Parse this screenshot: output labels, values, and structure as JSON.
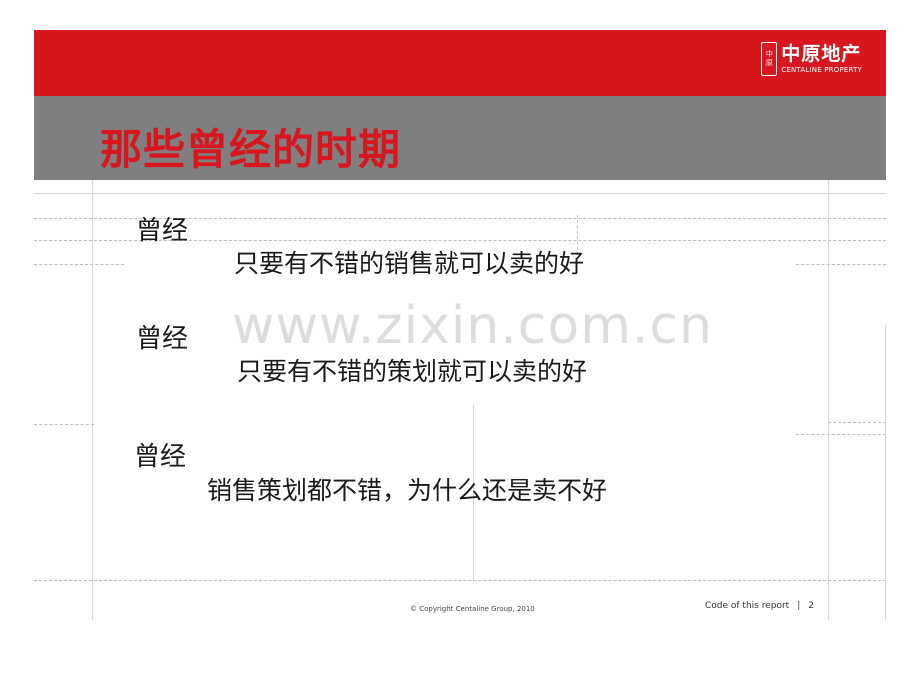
{
  "logo": {
    "seal_top": "中",
    "seal_bottom": "原",
    "name_cn": "中原地产",
    "name_en": "CENTALINE PROPERTY"
  },
  "title": "那些曾经的时期",
  "items": [
    {
      "label": "曾经",
      "text": "只要有不错的销售就可以卖的好"
    },
    {
      "label": "曾经",
      "text": "只要有不错的策划就可以卖的好"
    },
    {
      "label": "曾经",
      "text": "销售策划都不错，为什么还是卖不好"
    }
  ],
  "watermark": "www.zixin.com.cn",
  "footer": {
    "copyright": "© Copyright  Centaline Group, 2010",
    "report_code": "Code of this report",
    "separator": "|",
    "page_number": "2"
  },
  "colors": {
    "header_red": "#d7161e",
    "header_gray": "#7f7f7f",
    "title_red": "#d7161e"
  }
}
